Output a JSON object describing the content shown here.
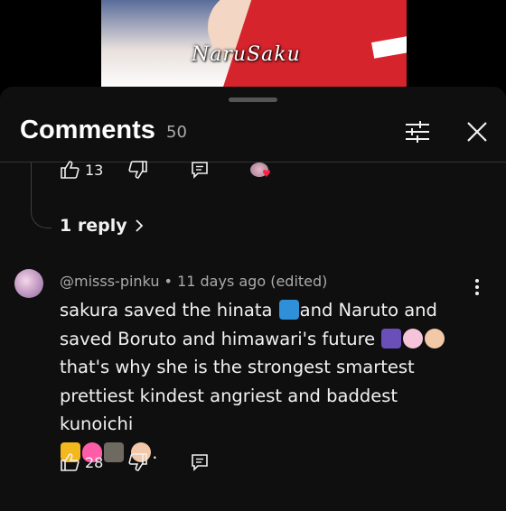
{
  "video": {
    "watermark": "NaruSaku"
  },
  "panel": {
    "title": "Comments",
    "count": "50"
  },
  "prev_reply": {
    "likes": "13"
  },
  "replies_link": {
    "label": "1 reply"
  },
  "comment": {
    "author": "@misss-pinku",
    "separator": "•",
    "time": "11 days ago",
    "edited": "(edited)",
    "meta_line": "@misss-pinku • 11 days ago (edited)",
    "lines": [
      "sakura saved the hinata",
      "and Naruto and",
      "saved Boruto and himawari's future",
      "that's why she is the strongest smartest",
      "prettiest kindest angriest and baddest kunoichi",
      "."
    ],
    "likes": "28"
  },
  "icons": {
    "filter": "sliders-icon",
    "close": "close-icon",
    "like": "thumbs-up-icon",
    "dislike": "thumbs-down-icon",
    "reply": "reply-icon",
    "more": "more-vertical-icon"
  },
  "colors": {
    "background": "#0f0f0f",
    "text": "#f1f1f1",
    "secondary": "#aaaaaa",
    "heart": "#ff1f3d"
  }
}
